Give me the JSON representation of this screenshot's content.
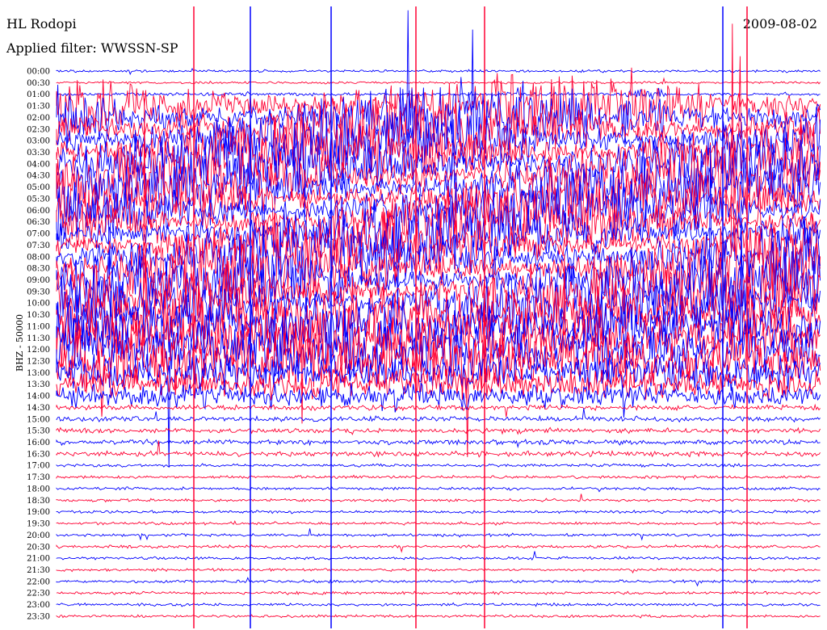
{
  "header": {
    "station": "HL Rodopi",
    "filter": "Applied filter: WWSSN-SP",
    "date": "2009-08-02"
  },
  "chart_data": {
    "type": "line",
    "title": "HL Rodopi",
    "subtitle": "Applied filter: WWSSN-SP",
    "date": "2009-08-02",
    "ylabel": "BHZ - 50000",
    "row_labels": [
      "00:00",
      "00:30",
      "01:00",
      "01:30",
      "02:00",
      "02:30",
      "03:00",
      "03:30",
      "04:00",
      "04:30",
      "05:00",
      "05:30",
      "06:00",
      "06:30",
      "07:00",
      "07:30",
      "08:00",
      "08:30",
      "09:00",
      "09:30",
      "10:00",
      "10:30",
      "11:00",
      "11:30",
      "12:00",
      "12:30",
      "13:00",
      "13:30",
      "14:00",
      "14:30",
      "15:00",
      "15:30",
      "16:00",
      "16:30",
      "17:00",
      "17:30",
      "18:00",
      "18:30",
      "19:00",
      "19:30",
      "20:00",
      "20:30",
      "21:00",
      "21:30",
      "22:00",
      "22:30",
      "23:00",
      "23:30"
    ],
    "row_colors": [
      "#0000ff",
      "#ff0033"
    ],
    "grid": false,
    "legend": "none"
  }
}
